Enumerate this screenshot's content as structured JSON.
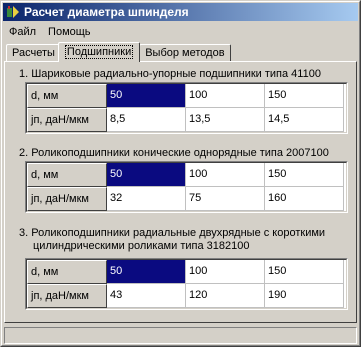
{
  "window": {
    "title": "Расчет диаметра шпинделя"
  },
  "menu": [
    "Файл",
    "Помощь"
  ],
  "tabs": [
    "Расчеты",
    "Подшипники",
    "Выбор методов"
  ],
  "active_tab": "Подшипники",
  "sections": [
    {
      "title": "1. Шариковые радиально-упорные подшипники типа 41100",
      "row_labels": [
        "d, мм",
        "jп, даН/мкм"
      ],
      "d_values": [
        "50",
        "100",
        "150"
      ],
      "j_values": [
        "8,5",
        "13,5",
        "14,5"
      ]
    },
    {
      "title": "2. Роликоподшипники конические однорядные типа 2007100",
      "row_labels": [
        "d, мм",
        "jп, даН/мкм"
      ],
      "d_values": [
        "50",
        "100",
        "150"
      ],
      "j_values": [
        "32",
        "75",
        "160"
      ]
    },
    {
      "title_line1": "3. Роликоподшипники радиальные двухрядные с короткими",
      "title_line2": "цилиндрическими роликами типа 3182100",
      "row_labels": [
        "d, мм",
        "jп, даН/мкм"
      ],
      "d_values": [
        "50",
        "100",
        "150"
      ],
      "j_values": [
        "43",
        "120",
        "190"
      ]
    }
  ],
  "colors": {
    "selection": "#0a0a80",
    "titlebar_start": "#0a246a",
    "titlebar_end": "#a6caf0"
  }
}
